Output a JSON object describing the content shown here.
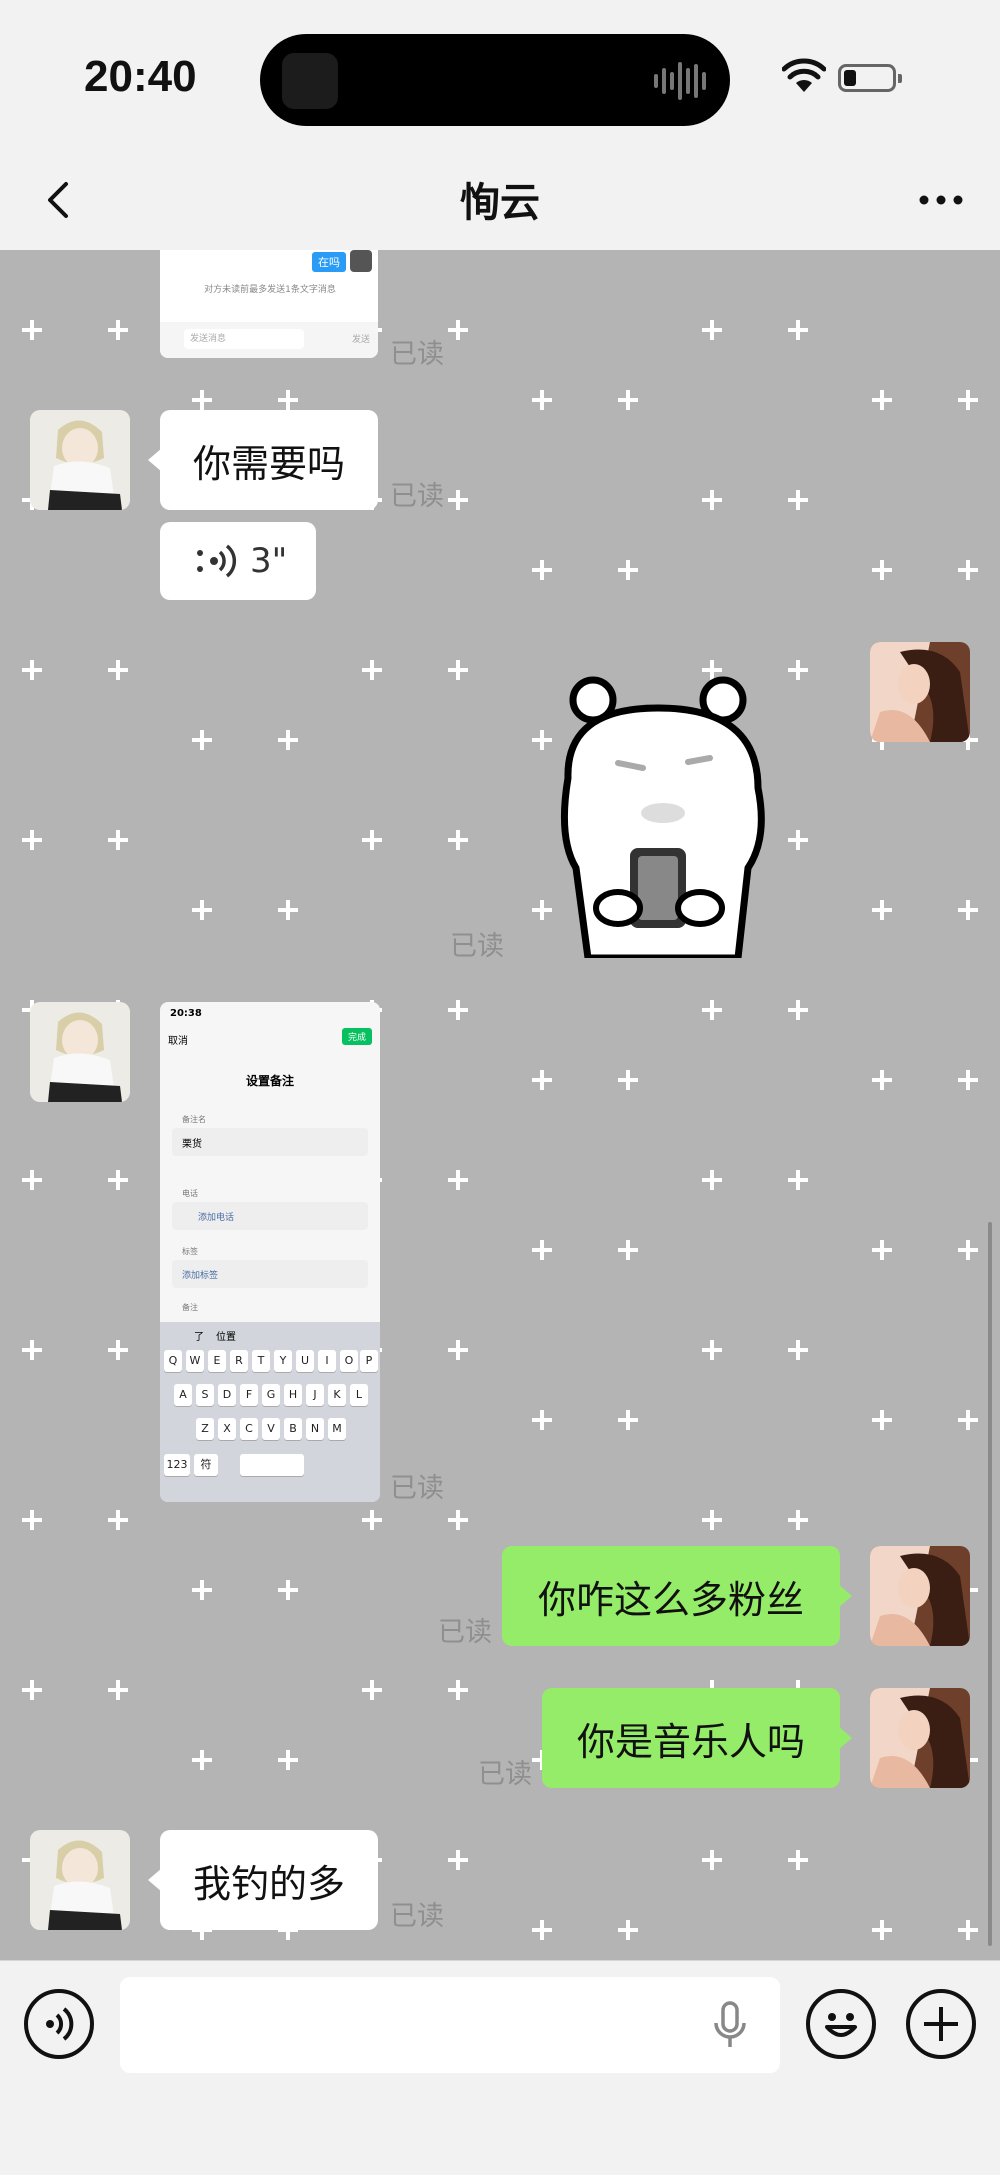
{
  "status_bar": {
    "time": "20:40"
  },
  "header": {
    "title": "恂云"
  },
  "messages": {
    "m1_read": "已读",
    "m2_text": "你需要吗",
    "m2_read": "已读",
    "m3_voice": "3\"",
    "m4_read": "已读",
    "m5_read": "已读",
    "m6_text": "你咋这么多粉丝",
    "m6_read": "已读",
    "m7_text": "你是音乐人吗",
    "m7_read": "已读",
    "m8_text": "我钓的多",
    "m8_read": "已读"
  },
  "screenshot1": {
    "tag": "在吗",
    "notice": "对方未读前最多发送1条文字消息",
    "input_placeholder": "发送消息",
    "send": "发送"
  },
  "screenshot2": {
    "time": "20:38",
    "cancel": "取消",
    "done": "完成",
    "title": "设置备注",
    "remark_label": "备注名",
    "remark_value": "栗货",
    "phone_label": "电话",
    "add_phone": "添加电话",
    "tag_label": "标签",
    "add_tag": "添加标签",
    "desc_label": "备注",
    "sugg1": "了",
    "sugg2": "位置",
    "row1": [
      "Q",
      "W",
      "E",
      "R",
      "T",
      "Y",
      "U",
      "I",
      "O",
      "P"
    ],
    "row2": [
      "A",
      "S",
      "D",
      "F",
      "G",
      "H",
      "J",
      "K",
      "L"
    ],
    "row3": [
      "Z",
      "X",
      "C",
      "V",
      "B",
      "N",
      "M"
    ],
    "key_123": "123",
    "key_sym": "符"
  },
  "input_bar": {
    "placeholder": ""
  },
  "colors": {
    "chat_bg": "#b4b4b4",
    "bubble_green": "#95ec69",
    "bubble_white": "#ffffff",
    "bar_bg": "#f2f2f2"
  },
  "icons": [
    "back-icon",
    "more-icon",
    "voice-mode-icon",
    "mic-icon",
    "emoji-icon",
    "plus-icon",
    "wifi-icon",
    "battery-icon"
  ]
}
